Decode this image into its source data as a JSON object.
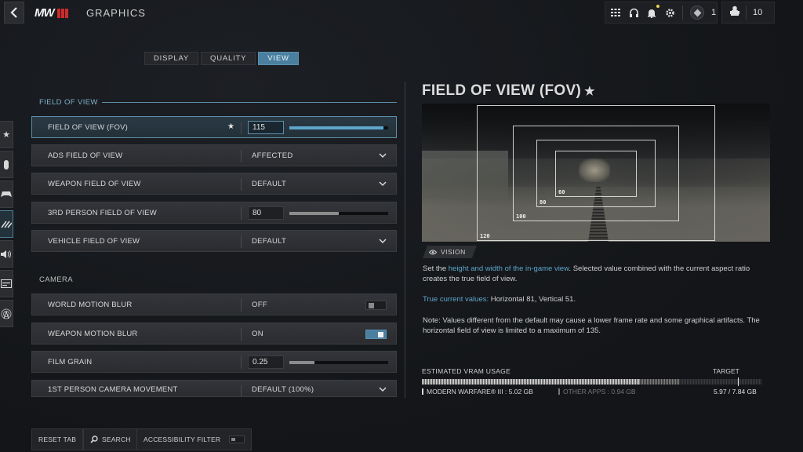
{
  "header": {
    "title": "GRAPHICS",
    "logo_text": "MW",
    "back_icon": "chevron-left-icon",
    "top_icons": [
      "grid-icon",
      "headset-icon",
      "bell-icon",
      "gear-icon"
    ],
    "rank_value": "1",
    "party_count": "10",
    "notification_color": "#e6d44a"
  },
  "tabs": [
    {
      "label": "DISPLAY",
      "active": false
    },
    {
      "label": "QUALITY",
      "active": false
    },
    {
      "label": "VIEW",
      "active": true
    }
  ],
  "rail": [
    {
      "icon": "star-icon",
      "active": false
    },
    {
      "icon": "mouse-icon",
      "active": false
    },
    {
      "icon": "gamepad-icon",
      "active": false
    },
    {
      "icon": "graphics-icon",
      "active": true
    },
    {
      "icon": "speaker-icon",
      "active": false
    },
    {
      "icon": "interface-icon",
      "active": false
    },
    {
      "icon": "network-icon",
      "active": false
    }
  ],
  "sections": {
    "fov": "FIELD OF VIEW",
    "camera": "CAMERA"
  },
  "settings": [
    {
      "label": "FIELD OF VIEW (FOV)",
      "type": "slider",
      "value": "115",
      "fill": 0.95,
      "favorite": true,
      "selected": true
    },
    {
      "label": "ADS FIELD OF VIEW",
      "type": "dropdown",
      "value": "AFFECTED"
    },
    {
      "label": "WEAPON FIELD OF VIEW",
      "type": "dropdown",
      "value": "DEFAULT"
    },
    {
      "label": "3RD PERSON FIELD OF VIEW",
      "type": "slider",
      "value": "80",
      "fill": 0.5
    },
    {
      "label": "VEHICLE FIELD OF VIEW",
      "type": "dropdown",
      "value": "DEFAULT"
    },
    {
      "label": "WORLD MOTION BLUR",
      "type": "toggle",
      "value": "OFF",
      "on": false
    },
    {
      "label": "WEAPON MOTION BLUR",
      "type": "toggle",
      "value": "ON",
      "on": true
    },
    {
      "label": "FILM GRAIN",
      "type": "slider",
      "value": "0.25",
      "fill": 0.25
    },
    {
      "label": "1ST PERSON CAMERA MOVEMENT",
      "type": "dropdown",
      "value": "DEFAULT (100%)"
    }
  ],
  "detail": {
    "title": "FIELD OF VIEW (FOV)",
    "star": "★",
    "preview_labels": [
      "120",
      "100",
      "80",
      "60"
    ],
    "badge": "VISION",
    "desc_prefix": "Set the ",
    "desc_highlight": "height and width of the in-game view",
    "desc_suffix": ". Selected value combined with the current aspect ratio creates the true field of view.",
    "true_label": "True current values:",
    "true_values": " Horizontal 81, Vertical 51.",
    "note": "Note: Values different from the default may cause a lower frame rate and some graphical artifacts. The horizontal field of view is limited to a maximum of 135."
  },
  "vram": {
    "label": "ESTIMATED VRAM USAGE",
    "target_label": "TARGET",
    "game_usage": "MODERN WARFARE® III : 5.02 GB",
    "other_usage": "OTHER APPS : 0.94 GB",
    "total": "5.97 / 7.84 GB",
    "game_gb": 5.02,
    "other_gb": 0.94,
    "target_gb": 7.3,
    "max_gb": 7.84
  },
  "footer": {
    "reset": "RESET TAB",
    "search": "SEARCH",
    "accessibility": "ACCESSIBILITY FILTER"
  },
  "colors": {
    "accent": "#4a7fa0",
    "highlight_text": "#5ea6cc",
    "brand_red": "#d02a2a"
  }
}
